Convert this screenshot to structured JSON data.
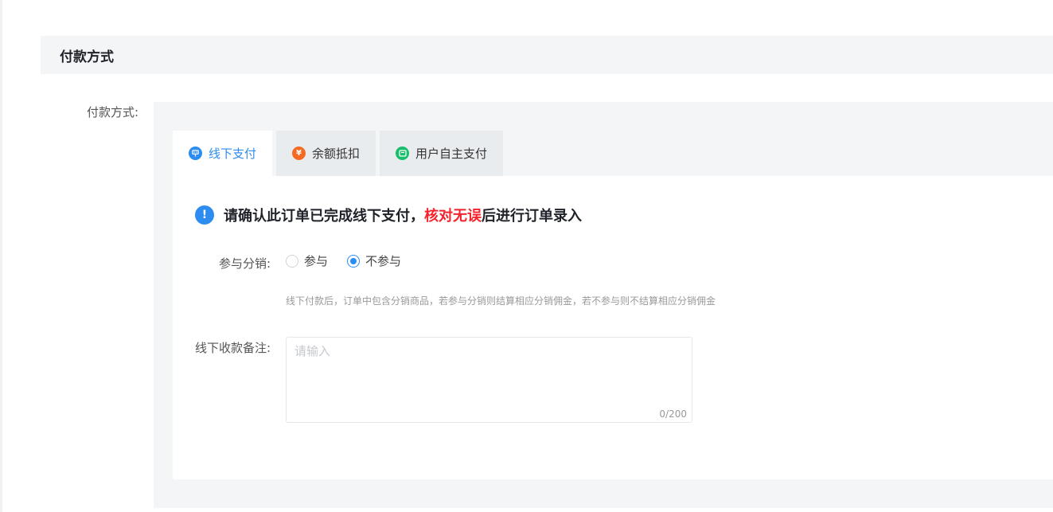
{
  "section": {
    "title": "付款方式"
  },
  "payment": {
    "label": "付款方式:",
    "tabs": [
      {
        "label": "线下支付",
        "icon": "offline-pay-icon",
        "color": "#2d8cf0",
        "active": true
      },
      {
        "label": "余额抵扣",
        "icon": "balance-icon",
        "color": "#f56a22",
        "active": false
      },
      {
        "label": "用户自主支付",
        "icon": "wallet-icon",
        "color": "#19be6b",
        "active": false
      }
    ]
  },
  "notice": {
    "prefix": "请确认此订单已完成线下支付，",
    "highlight": "核对无误",
    "suffix": "后进行订单录入"
  },
  "distribution": {
    "label": "参与分销:",
    "options": [
      "参与",
      "不参与"
    ],
    "selected": "不参与",
    "hint": "线下付款后，订单中包含分销商品，若参与分销则结算相应分销佣金，若不参与则不结算相应分销佣金"
  },
  "remark": {
    "label": "线下收款备注:",
    "placeholder": "请输入",
    "value": "",
    "counter": "0/200"
  },
  "colors": {
    "accent": "#2d8cf0",
    "highlight": "#f5222d"
  }
}
